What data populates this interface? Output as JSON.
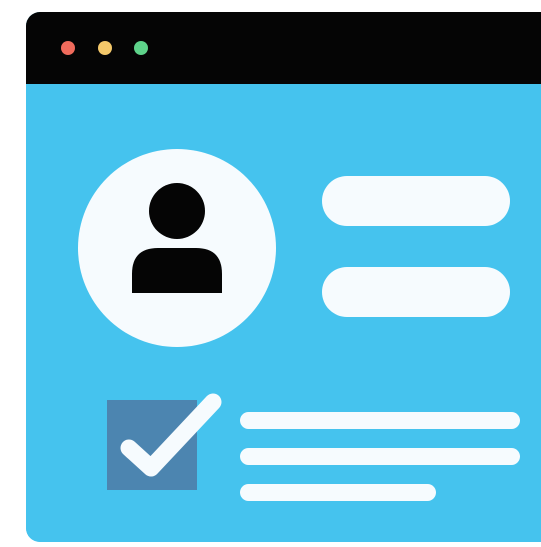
{
  "colors": {
    "titlebar": "#050505",
    "window_background": "#45c3ee",
    "panel_white": "#f6fbfe",
    "checkbox_fill": "#4c85b0",
    "dot_red": "#f06b5c",
    "dot_yellow": "#f4c86a",
    "dot_green": "#5ed38a"
  },
  "icons": {
    "avatar": "user-silhouette-icon",
    "checkbox": "checkmark-icon"
  },
  "checkbox": {
    "checked": true
  }
}
